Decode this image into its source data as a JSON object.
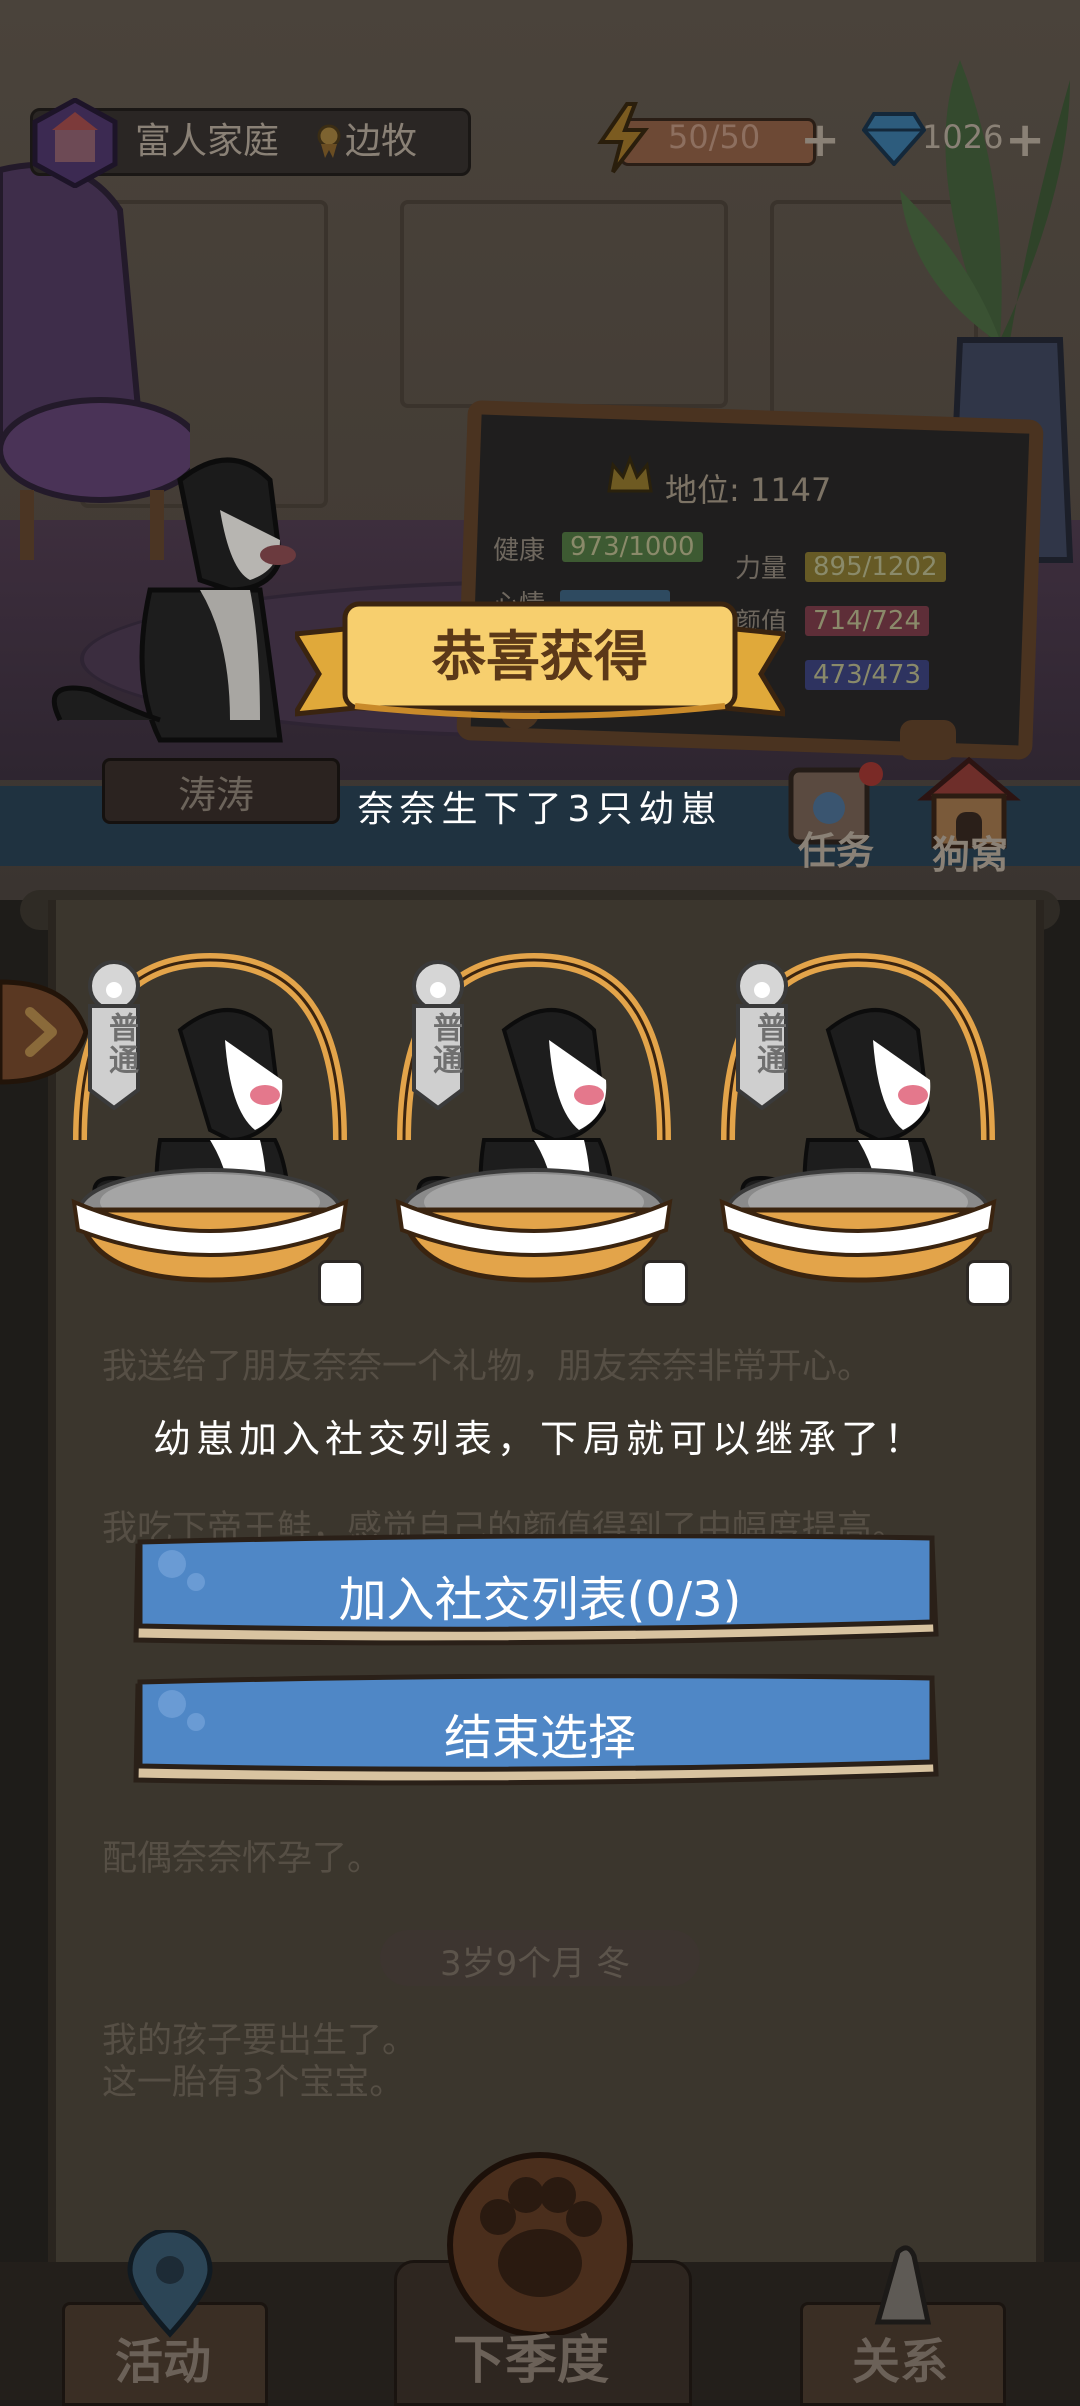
{
  "top_bar": {
    "family": "富人家庭",
    "title": "边牧",
    "energy": "50/50",
    "gems": "1026",
    "plus_icon": "plus-icon"
  },
  "status_board": {
    "status": "地位: 1147",
    "stats": [
      {
        "label": "健康",
        "value": "973/1000",
        "color": "#4a7a3c"
      },
      {
        "label": "力量",
        "value": "895/1202",
        "color": "#7d6f2a"
      },
      {
        "label": "心情",
        "value": "",
        "color": "#3a5d7a"
      },
      {
        "label": "颜值",
        "value": "714/724",
        "color": "#7a3846"
      },
      {
        "label": "",
        "value": "473/473",
        "color": "#3a3f7a"
      }
    ]
  },
  "dog_name": "涛涛",
  "side_buttons": {
    "tasks": "任务",
    "kennel": "狗窝"
  },
  "log": {
    "lines": [
      "我送给了朋友奈奈一个礼物，朋友奈奈非常开心。",
      "我吃下帝王鲑，感觉自己的颜值得到了中幅度提高。",
      "配偶奈奈怀孕了。"
    ],
    "season": "3岁9个月 冬",
    "birth_lines": [
      "我的孩子要出生了。",
      "这一胎有3个宝宝。"
    ]
  },
  "nav": {
    "left": "活动",
    "middle": "下季度",
    "right": "关系"
  },
  "modal": {
    "title": "恭喜获得",
    "subtitle": "奈奈生下了3只幼崽",
    "puppies": [
      {
        "quality": "普通",
        "selected": false
      },
      {
        "quality": "普通",
        "selected": false
      },
      {
        "quality": "普通",
        "selected": false
      }
    ],
    "hint": "幼崽加入社交列表，下局就可以继承了！",
    "add_button": "加入社交列表(0/3)",
    "end_button": "结束选择"
  },
  "colors": {
    "ribbon": "#f7cf6e",
    "button_blue": "#4f87c6",
    "basket": "#e3a44a"
  }
}
